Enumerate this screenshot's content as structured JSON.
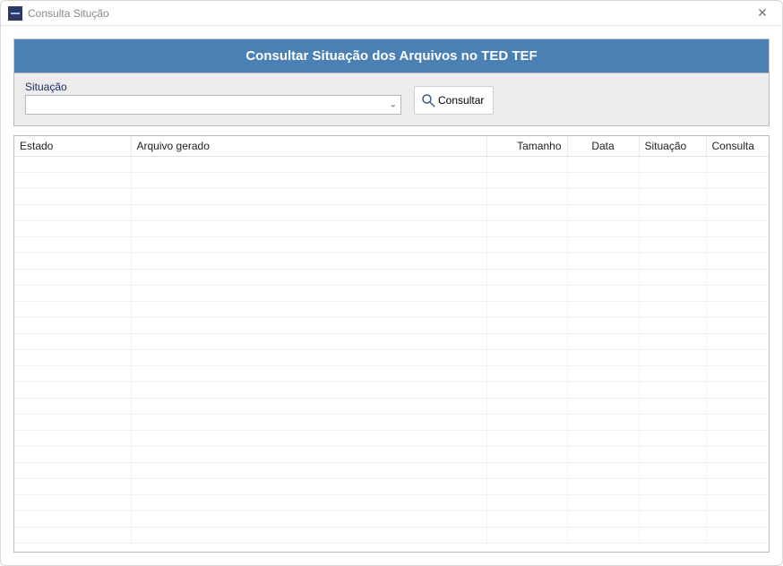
{
  "window": {
    "title": "Consulta Situção"
  },
  "banner": {
    "text": "Consultar Situação dos Arquivos no TED TEF"
  },
  "filter": {
    "situacao_label": "Situação",
    "situacao_value": "",
    "consultar_label": "Consultar"
  },
  "grid": {
    "columns": {
      "estado": "Estado",
      "arquivo": "Arquivo gerado",
      "tamanho": "Tamanho",
      "data": "Data",
      "situacao": "Situação",
      "consulta": "Consulta"
    },
    "rows": []
  },
  "colors": {
    "banner_bg": "#4a80b4",
    "banner_fg": "#ffffff",
    "label_fg": "#1b2f6b"
  }
}
